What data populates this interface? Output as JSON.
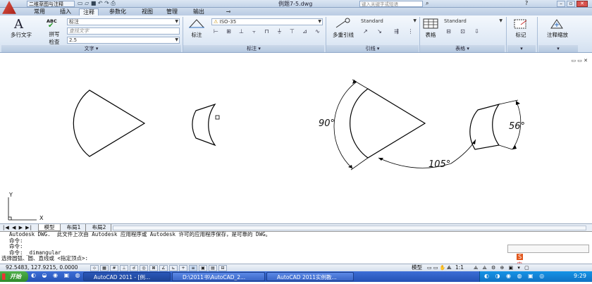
{
  "titlebar": {
    "workspace": "二维草图与注释",
    "filename": "例题7-5.dwg",
    "search_placeholder": "键入关键字或短语"
  },
  "ribbon_tabs": [
    "常用",
    "插入",
    "注释",
    "参数化",
    "视图",
    "管理",
    "输出"
  ],
  "active_tab": "注释",
  "text_panel": {
    "multiline_text": "多行文字",
    "spell_check_line1": "拼写",
    "spell_check_line2": "检查",
    "abc": "ABC",
    "style_value": "标注",
    "find_placeholder": "查找文字",
    "height_value": "2.5",
    "label": "文字"
  },
  "dim_panel": {
    "dimension_button": "标注",
    "dimstyle_value": "ISO-35",
    "label": "标注"
  },
  "leader_panel": {
    "multileader_button": "多重引线",
    "style_value": "Standard",
    "label": "引线"
  },
  "table_panel": {
    "table_button": "表格",
    "style_value": "Standard",
    "label": "表格"
  },
  "markup_panel": {
    "button": "标记"
  },
  "scale_panel": {
    "button": "注释缩放"
  },
  "drawing": {
    "dim_90": "90°",
    "dim_105": "105°",
    "dim_56": "56°",
    "ucs_y": "Y",
    "ucs_x": "X"
  },
  "layout_tabs": [
    "模型",
    "布局1",
    "布局2"
  ],
  "command_lines": [
    "Autodesk DWG.  此文件上次由 Autodesk 应用程序或 Autodesk 许可的应用程序保存，是可靠的 DWG。",
    "命令:",
    "命令:",
    "命令: _dimangular",
    "选择圆弧、圆、直线或 <指定顶点>:"
  ],
  "ime_text": "中",
  "status": {
    "coordinates": "92.5483,  127.9215,  0.0000",
    "model_label": "模型",
    "scale": "1:1"
  },
  "taskbar": {
    "start": "开始",
    "tasks": [
      "AutoCAD 2011 - [例...",
      "D:\\2011书\\AutoCAD_2...",
      "AutoCAD 2011实例教..."
    ],
    "clock": "9:29"
  },
  "colors": {
    "ribbon_bg": "#dfe9f5",
    "taskbar": "#2451b5",
    "autocad_logo": "#c0392b"
  }
}
